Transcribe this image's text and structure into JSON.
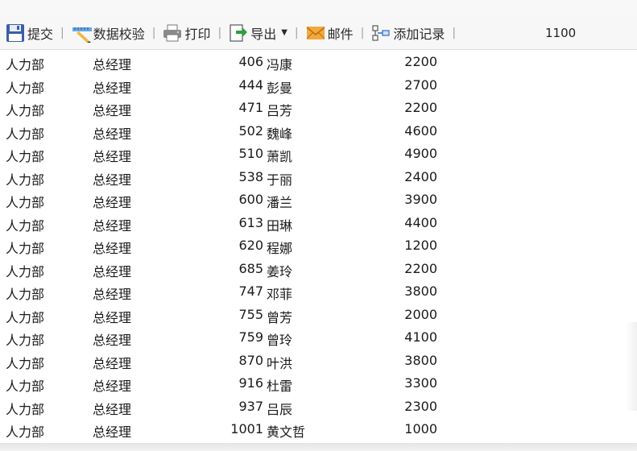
{
  "toolbar": {
    "submit_label": "提交",
    "validate_label": "数据校验",
    "print_label": "打印",
    "export_label": "导出",
    "email_label": "邮件",
    "add_record_label": "添加记录",
    "separator": "|",
    "number": "1100"
  },
  "table": {
    "rows": [
      {
        "dept": "人力部",
        "title": "总经理",
        "id": "406",
        "name": "冯康",
        "amount": "2200"
      },
      {
        "dept": "人力部",
        "title": "总经理",
        "id": "444",
        "name": "彭曼",
        "amount": "2700"
      },
      {
        "dept": "人力部",
        "title": "总经理",
        "id": "471",
        "name": "吕芳",
        "amount": "2200"
      },
      {
        "dept": "人力部",
        "title": "总经理",
        "id": "502",
        "name": "魏峰",
        "amount": "4600"
      },
      {
        "dept": "人力部",
        "title": "总经理",
        "id": "510",
        "name": "萧凯",
        "amount": "4900"
      },
      {
        "dept": "人力部",
        "title": "总经理",
        "id": "538",
        "name": "于丽",
        "amount": "2400"
      },
      {
        "dept": "人力部",
        "title": "总经理",
        "id": "600",
        "name": "潘兰",
        "amount": "3900"
      },
      {
        "dept": "人力部",
        "title": "总经理",
        "id": "613",
        "name": "田琳",
        "amount": "4400"
      },
      {
        "dept": "人力部",
        "title": "总经理",
        "id": "620",
        "name": "程娜",
        "amount": "1200"
      },
      {
        "dept": "人力部",
        "title": "总经理",
        "id": "685",
        "name": "姜玲",
        "amount": "2200"
      },
      {
        "dept": "人力部",
        "title": "总经理",
        "id": "747",
        "name": "邓菲",
        "amount": "3800"
      },
      {
        "dept": "人力部",
        "title": "总经理",
        "id": "755",
        "name": "曾芳",
        "amount": "2000"
      },
      {
        "dept": "人力部",
        "title": "总经理",
        "id": "759",
        "name": "曾玲",
        "amount": "4100"
      },
      {
        "dept": "人力部",
        "title": "总经理",
        "id": "870",
        "name": "叶洪",
        "amount": "3800"
      },
      {
        "dept": "人力部",
        "title": "总经理",
        "id": "916",
        "name": "杜雷",
        "amount": "3300"
      },
      {
        "dept": "人力部",
        "title": "总经理",
        "id": "937",
        "name": "吕辰",
        "amount": "2300"
      },
      {
        "dept": "人力部",
        "title": "总经理",
        "id": "1001",
        "name": "黄文哲",
        "amount": "1000"
      }
    ]
  }
}
